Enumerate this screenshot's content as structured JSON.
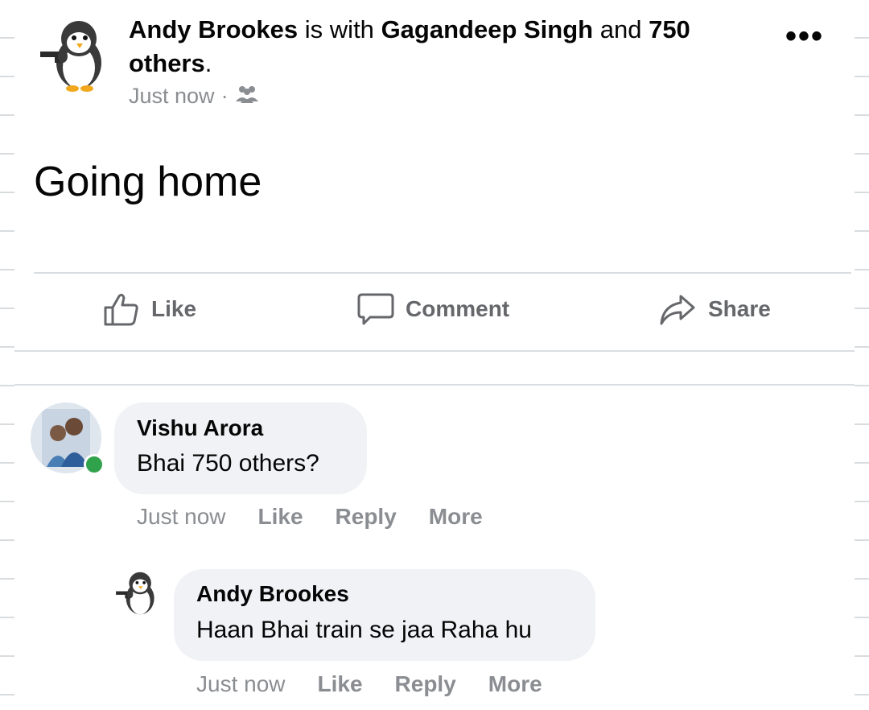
{
  "post": {
    "author": "Andy Brookes",
    "with_text": "is with",
    "tagged": "Gagandeep Singh",
    "and_text": "and",
    "others_count": "750",
    "others_word": "others",
    "period": ".",
    "time": "Just now",
    "separator": "·",
    "audience_icon": "friends-icon",
    "menu_icon": "more-dots-icon",
    "text": "Going home"
  },
  "actions": {
    "like": "Like",
    "comment": "Comment",
    "share": "Share"
  },
  "comments": [
    {
      "author": "Vishu Arora",
      "text": "Bhai 750 others?",
      "time": "Just now",
      "like": "Like",
      "reply": "Reply",
      "more": "More",
      "online": true
    },
    {
      "author": "Andy Brookes",
      "text": "Haan Bhai train se jaa Raha hu",
      "time": "Just now",
      "like": "Like",
      "reply": "Reply",
      "more": "More"
    }
  ],
  "colors": {
    "secondary_text": "#65676b",
    "meta_text": "#8a8d91",
    "bubble_bg": "#f0f2f5",
    "online": "#31a24c",
    "divider": "#dadde1"
  }
}
